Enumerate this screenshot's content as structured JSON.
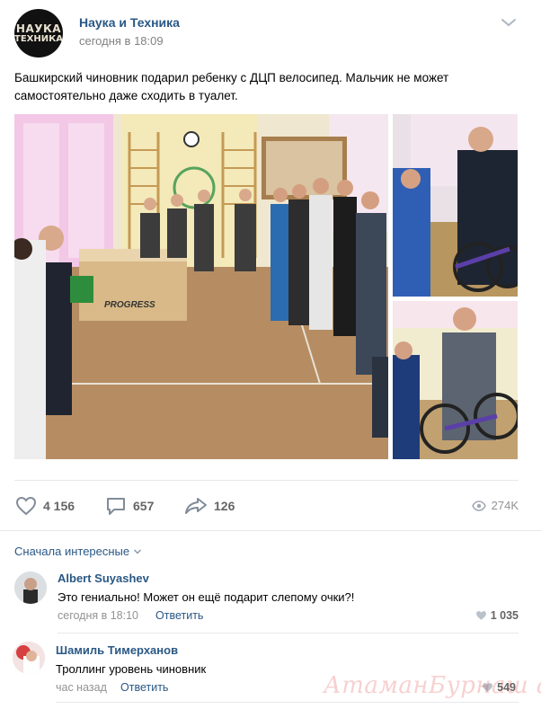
{
  "post": {
    "group_name": "Наука и Техника",
    "time": "сегодня в 18:09",
    "avatar_line1": "НАУКА",
    "avatar_line2": "ТЕХНИКА",
    "text": "Башкирский чиновник подарил ребенку с ДЦП велосипед. Мальчик не может самостоятельно даже сходить в туалет.",
    "photo_box_label": "PROGRESS"
  },
  "actions": {
    "likes": "4 156",
    "comments": "657",
    "shares": "126",
    "views": "274K"
  },
  "comments_section": {
    "sort_label": "Сначала интересные"
  },
  "comments": [
    {
      "author": "Albert Suyashev",
      "text": "Это гениально! Может он ещё подарит слепому очки?!",
      "time": "сегодня в 18:10",
      "reply": "Ответить",
      "likes": "1 035"
    },
    {
      "author": "Шамиль Тимерханов",
      "text": "Троллинг уровень чиновник",
      "time": "час назад",
      "reply": "Ответить",
      "likes": "549"
    }
  ],
  "watermark": "АтаманБурнаш аля ЯП",
  "colors": {
    "link": "#2a5885",
    "muted": "#828282",
    "divider": "#e7e8ec"
  }
}
